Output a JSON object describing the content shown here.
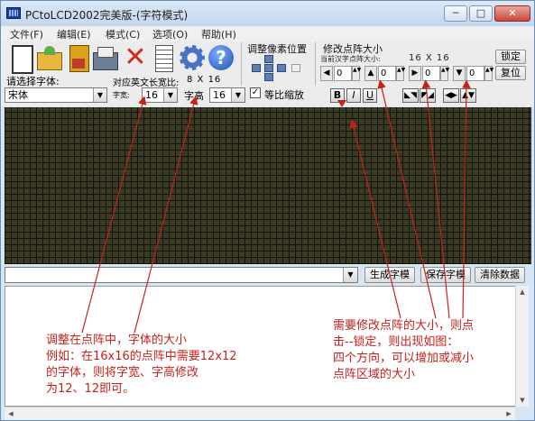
{
  "window": {
    "title": "PCtoLCD2002完美版-(字符模式)"
  },
  "titlebar_buttons": {
    "minimize": "─",
    "maximize": "□",
    "close": "✕"
  },
  "menu": [
    "文件(F)",
    "编辑(E)",
    "模式(C)",
    "选项(O)",
    "帮助(H)"
  ],
  "toolbar": {
    "icons": [
      "new-icon",
      "open-icon",
      "save-icon",
      "export-icon",
      "delete-icon",
      "document-icon",
      "settings-icon",
      "help-icon"
    ],
    "adjust_title": "调整像素位置",
    "matrix_title": "修改点阵大小",
    "matrix_sub": "当前汉字点阵大小:",
    "matrix_dims": "16 X 16",
    "lock_label": "锁定",
    "reset_label": "复位",
    "spinners": [
      {
        "dir": "left",
        "glyph": "◀",
        "value": "0"
      },
      {
        "dir": "up",
        "glyph": "▲",
        "value": "0"
      },
      {
        "dir": "right",
        "glyph": "▶",
        "value": "0"
      },
      {
        "dir": "down",
        "glyph": "▼",
        "value": "0"
      }
    ]
  },
  "font_controls": {
    "choose_font_label": "请选择字体:",
    "font_value": "宋体",
    "ascii_label": "对应英文长宽比:",
    "ascii_dims": "8 X 16",
    "width_label": "字宽:",
    "width_value": "16",
    "height_label": "字高",
    "height_value": "16",
    "proportional_label": "等比缩放",
    "proportional_checked": "✓",
    "bold": "B",
    "italic": "I",
    "underline": "U"
  },
  "actions": {
    "generate": "生成字模",
    "save_font": "保存字模",
    "clear": "清除数据"
  },
  "annotations": {
    "left": "调整在点阵中，字体的大小\n例如：在16x16的点阵中需要12x12\n的字体，则将字宽、字高修改\n为12、12即可。",
    "right": "需要修改点阵的大小，则点\n击--锁定，则出现如图：\n四个方向，可以增加或减小\n点阵区域的大小"
  },
  "colors": {
    "annotation": "#c8201b",
    "grid_bg": "#3b3b22"
  }
}
